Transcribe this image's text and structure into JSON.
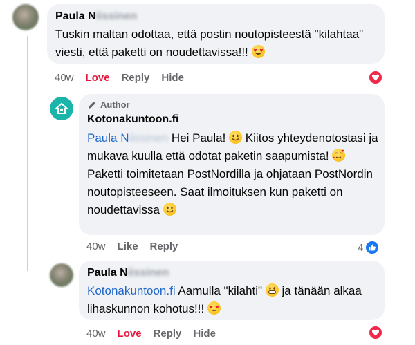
{
  "comments": [
    {
      "author_first": "Paula N",
      "author_blurred": "iissinen",
      "text": "Tuskin maltan odottaa, että postin noutopisteestä \"kilahtaa\" viesti, että paketti on noudettavissa!!!",
      "emoji": "heart-eyes",
      "time": "40w",
      "actions": [
        "Love",
        "Reply",
        "Hide"
      ],
      "reaction": "love"
    },
    {
      "author_badge": "Author",
      "author": "Kotonakuntoon.fi",
      "mention_first": "Paula N",
      "mention_blurred": "iissinen",
      "text_1": " Hei Paula! ",
      "text_2": " Kiitos yhteydenotostasi ja mukava kuulla että odotat paketin saapumista! ",
      "text_3": " Paketti toimitetaan PostNordilla ja ohjataan PostNordin noutopisteeseen. Saat ilmoituksen kun paketti on noudettavissa ",
      "time": "40w",
      "actions": [
        "Like",
        "Reply"
      ],
      "reaction_count": "4",
      "reaction": "like"
    },
    {
      "author_first": "Paula N",
      "author_blurred": "iissinen",
      "mention": "Kotonakuntoon.fi",
      "text_1": " Aamulla \"kilahti\" ",
      "text_2": " ja tänään alkaa lihaskunnon kohotus!!! ",
      "time": "40w",
      "actions": [
        "Love",
        "Reply",
        "Hide"
      ],
      "reaction": "love"
    }
  ],
  "colors": {
    "love": "#e4193f",
    "like": "#1877f2",
    "link": "#1f66c9",
    "bubble": "#f0f2f5"
  }
}
